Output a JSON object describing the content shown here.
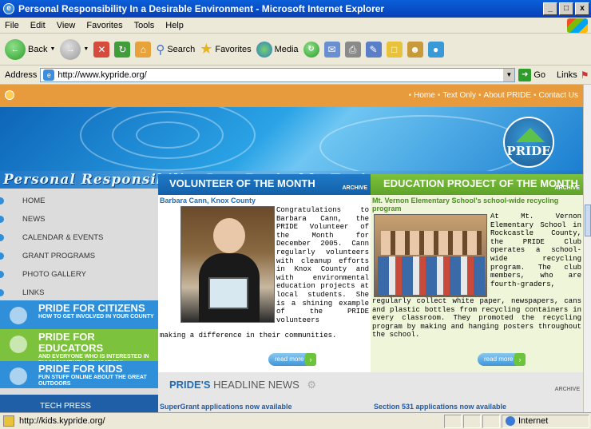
{
  "window": {
    "title": "Personal Responsibility In a Desirable Environment - Microsoft Internet Explorer"
  },
  "menu": [
    "File",
    "Edit",
    "View",
    "Favorites",
    "Tools",
    "Help"
  ],
  "toolbar": {
    "back": "Back",
    "search": "Search",
    "favorites": "Favorites",
    "media": "Media"
  },
  "address": {
    "label": "Address",
    "url": "http://www.kypride.org/",
    "go": "Go",
    "links": "Links"
  },
  "page": {
    "top_links": [
      "Home",
      "Text Only",
      "About PRIDE",
      "Contact Us"
    ],
    "logo_text": "PRIDE",
    "tagline": "Personal Responsibility In a Desirable Environment",
    "nav": [
      "HOME",
      "NEWS",
      "CALENDAR & EVENTS",
      "GRANT PROGRAMS",
      "PHOTO GALLERY",
      "LINKS"
    ],
    "promos": [
      {
        "title": "PRIDE FOR CITIZENS",
        "sub": "HOW TO GET INVOLVED IN YOUR COUNTY",
        "color": "#2f8fd8"
      },
      {
        "title": "PRIDE FOR EDUCATORS",
        "sub": "AND EVERYONE WHO IS INTERESTED IN ENVIRONMENTAL EDUCATION!",
        "color": "#7cc23c"
      },
      {
        "title": "PRIDE FOR KIDS",
        "sub": "FUN STUFF ONLINE ABOUT THE GREAT OUTDOORS",
        "color": "#2f8fd8"
      }
    ],
    "tech_press": "TECH PRESS",
    "volunteer": {
      "heading": "VOLUNTEER OF THE MONTH",
      "archive": "ARCHIVE",
      "name": "Barbara Cann, Knox County",
      "text_right": "Congratulations to Barbara Cann, the PRIDE Volunteer of the Month for December 2005. Cann regularly volunteers with cleanup efforts in Knox County and with environmental education projects at local students. She is a shining example of the PRIDE volunteers",
      "text_bottom": "making a difference in their communities.",
      "read_more": "read more"
    },
    "education": {
      "heading": "EDUCATION PROJECT OF THE MONTH",
      "archive": "ARCHIVE",
      "subtitle": "Mt. Vernon Elementary School's school-wide recycling program",
      "text_right": "At Mt. Vernon Elementary School in Rockcastle County, the PRIDE Club operates a school-wide recycling program. The club members, who are fourth-graders,",
      "text_bottom": "regularly collect white paper, newspapers, cans and plastic bottles from recycling containers in every classroom. They promoted the recycling program by making and hanging posters throughout the school.",
      "read_more": "read more"
    },
    "news": {
      "heading_bold": "PRIDE'S",
      "heading_rest": "HEADLINE NEWS",
      "archive": "ARCHIVE",
      "items": [
        "SuperGrant applications now available",
        "Section 531 applications now available"
      ]
    }
  },
  "status": {
    "url": "http://kids.kypride.org/",
    "zone": "Internet"
  }
}
